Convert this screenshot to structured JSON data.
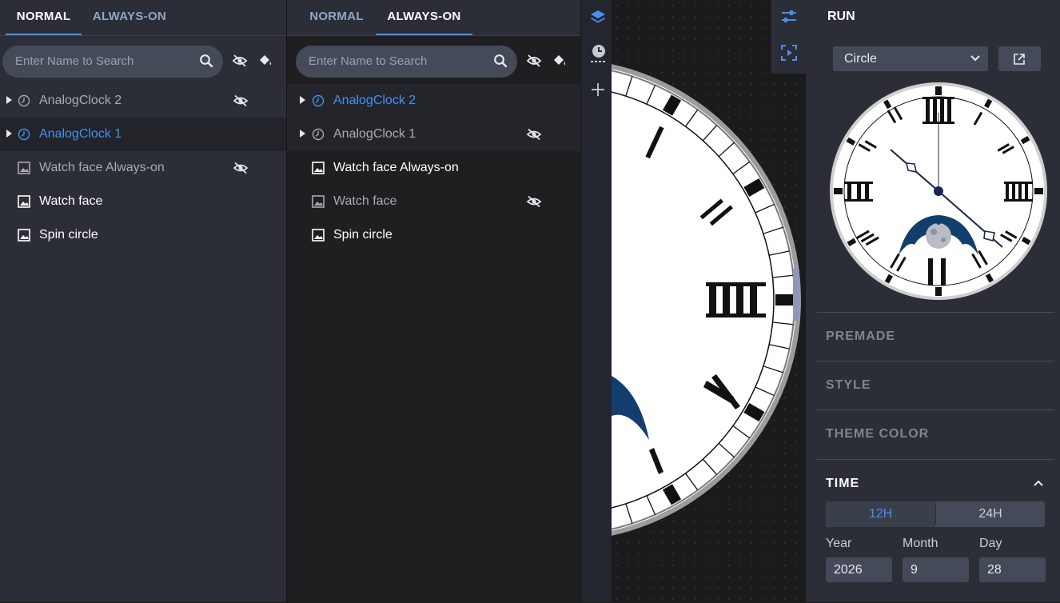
{
  "left_panel": {
    "tabs": [
      "NORMAL",
      "ALWAYS-ON"
    ],
    "active_tab": "NORMAL",
    "search_placeholder": "Enter Name to Search",
    "layers": [
      {
        "label": "AnalogClock 2",
        "state": "hidden"
      },
      {
        "label": "AnalogClock 1",
        "state": "selected"
      },
      {
        "label": "Watch face Always-on",
        "state": "hidden"
      },
      {
        "label": "Watch face",
        "state": "visible"
      },
      {
        "label": "Spin circle",
        "state": "visible"
      }
    ]
  },
  "middle_panel": {
    "tabs": [
      "NORMAL",
      "ALWAYS-ON"
    ],
    "active_tab": "ALWAYS-ON",
    "search_placeholder": "Enter Name to Search",
    "layers": [
      {
        "label": "AnalogClock 2",
        "state": "selected"
      },
      {
        "label": "AnalogClock 1",
        "state": "hidden"
      },
      {
        "label": "Watch face Always-on",
        "state": "visible"
      },
      {
        "label": "Watch face",
        "state": "hidden"
      },
      {
        "label": "Spin circle",
        "state": "visible"
      }
    ]
  },
  "toolbar": {
    "icons": [
      "layers-icon",
      "clock-icon",
      "plus-icon"
    ]
  },
  "right_panel": {
    "title": "RUN",
    "shape_select": "Circle",
    "sections": [
      "PREMADE",
      "STYLE",
      "THEME COLOR"
    ],
    "time": {
      "title": "TIME",
      "format_options": [
        "12H",
        "24H"
      ],
      "active_format": "12H",
      "year_label": "Year",
      "month_label": "Month",
      "day_label": "Day",
      "year": "2026",
      "month": "9",
      "day": "28"
    }
  },
  "colors": {
    "accent": "#4a8ef0",
    "panel": "#2b2e36",
    "panel_dark": "#1f1f22",
    "moon_blue": "#123e6e"
  }
}
